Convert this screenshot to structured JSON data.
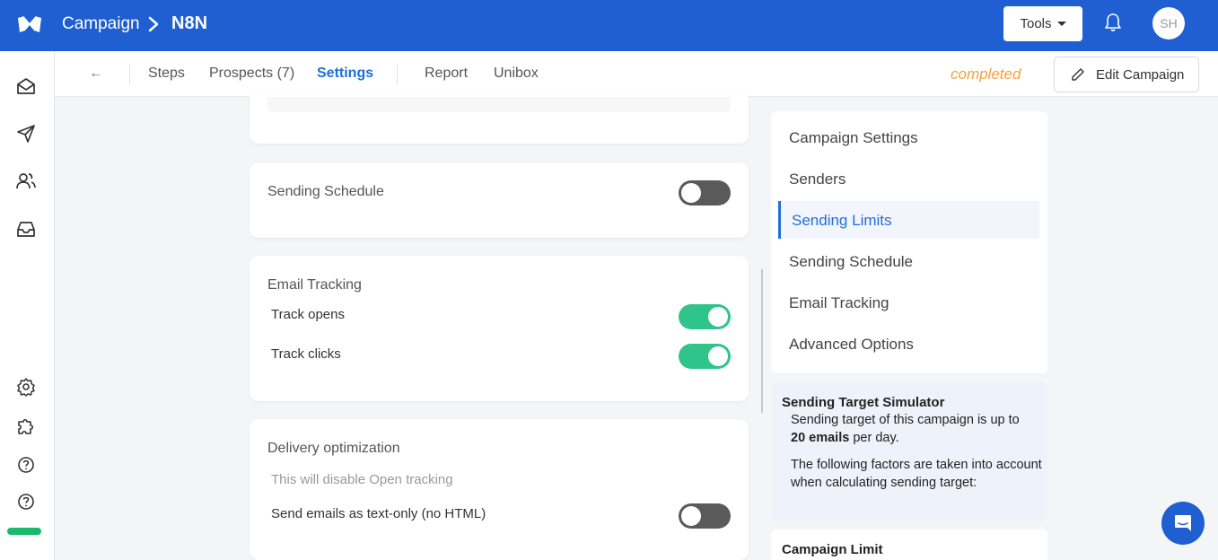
{
  "header": {
    "breadcrumb_root": "Campaign",
    "campaign_name": "N8N",
    "tools_label": "Tools",
    "avatar_initials": "SH",
    "brand_color": "#1f5fd1"
  },
  "rail": {
    "icons": [
      "mail-open-icon",
      "send-icon",
      "users-icon",
      "inbox-icon",
      "gear-icon",
      "puzzle-icon",
      "help-icon",
      "help-icon"
    ]
  },
  "tabs": {
    "back": "←",
    "items": [
      "Steps",
      "Prospects (7)",
      "Settings",
      "Report",
      "Unibox"
    ],
    "active": "Settings",
    "status": "completed",
    "edit_label": "Edit Campaign"
  },
  "main": {
    "sending_schedule": {
      "title": "Sending Schedule",
      "enabled": false
    },
    "email_tracking": {
      "title": "Email Tracking",
      "track_opens": {
        "label": "Track opens",
        "enabled": true
      },
      "track_clicks": {
        "label": "Track clicks",
        "enabled": true
      }
    },
    "delivery": {
      "title": "Delivery optimization",
      "hint": "This will disable Open tracking",
      "text_only": {
        "label": "Send emails as text-only (no HTML)",
        "enabled": false
      }
    }
  },
  "rightnav": {
    "items": [
      "Campaign Settings",
      "Senders",
      "Sending Limits",
      "Sending Schedule",
      "Email Tracking",
      "Advanced Options"
    ],
    "active": "Sending Limits"
  },
  "simulator": {
    "title": "Sending Target Simulator",
    "line1": "Sending target of this campaign is up to",
    "target": "20 emails",
    "line1_suffix": "per day.",
    "line2": "The following factors are taken into account when calculating sending target:"
  },
  "limit_card": {
    "title": "Campaign Limit"
  },
  "colors": {
    "toggle_on": "#2fc48a",
    "toggle_off": "#5a5a5a",
    "status": "#f2a23c",
    "accent": "#1f6fd8"
  }
}
